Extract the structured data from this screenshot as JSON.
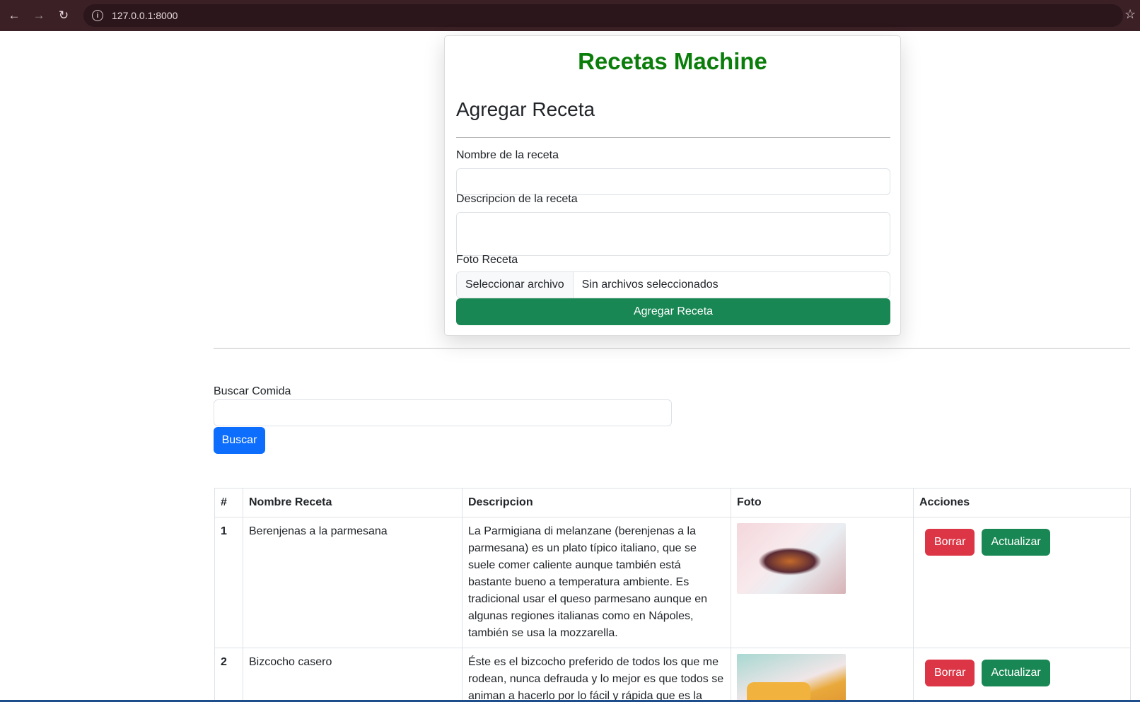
{
  "browser": {
    "url": "127.0.0.1:8000"
  },
  "form": {
    "app_title": "Recetas Machine",
    "heading": "Agregar Receta",
    "name_label": "Nombre de la receta",
    "name_value": "",
    "desc_label": "Descripcion de la receta",
    "desc_value": "",
    "photo_label": "Foto Receta",
    "file_button": "Seleccionar archivo",
    "file_status": "Sin archivos seleccionados",
    "submit_label": "Agregar Receta"
  },
  "search": {
    "label": "Buscar Comida",
    "value": "",
    "button": "Buscar"
  },
  "table": {
    "headers": [
      "#",
      "Nombre Receta",
      "Descripcion",
      "Foto",
      "Acciones"
    ],
    "rows": [
      {
        "num": "1",
        "name": "Berenjenas a la parmesana",
        "description": "La Parmigiana di melanzane (berenjenas a la parmesana) es un plato típico italiano, que se suele comer caliente aunque también está bastante bueno a temperatura ambiente. Es tradicional usar el queso parmesano aunque en algunas regiones italianas como en Nápoles, también se usa la mozzarella.",
        "delete_label": "Borrar",
        "update_label": "Actualizar"
      },
      {
        "num": "2",
        "name": "Bizcocho casero",
        "description": "Éste es el bizcocho preferido de todos los que me rodean, nunca defrauda y lo mejor es que todos se animan a hacerlo por lo fácil y rápida que es la",
        "delete_label": "Borrar",
        "update_label": "Actualizar"
      }
    ]
  }
}
